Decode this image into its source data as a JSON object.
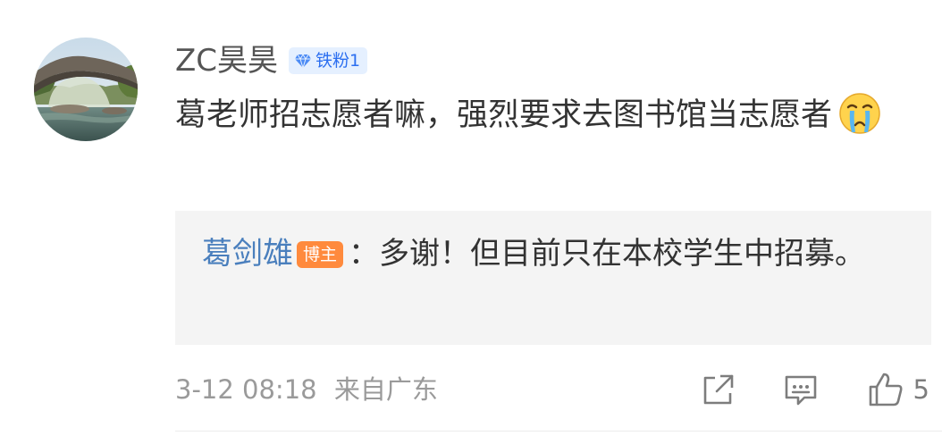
{
  "comment": {
    "username": "ZC昊昊",
    "fan_badge": "铁粉1",
    "text": "葛老师招志愿者嘛，强烈要求去图书馆当志愿者",
    "emoji": "crying-face"
  },
  "reply": {
    "author": "葛剑雄",
    "author_badge": "博主",
    "separator": "：",
    "text": "多谢！但目前只在本校学生中招募。"
  },
  "meta": {
    "time": "3-12 08:18",
    "source": "来自广东"
  },
  "actions": {
    "share_icon": "share-icon",
    "comment_icon": "comment-icon",
    "like_icon": "thumbs-up-icon",
    "like_count": "5"
  },
  "colors": {
    "link_blue": "#4a7fbd",
    "fan_badge_bg": "#e5f0ff",
    "fan_badge_text": "#2c6ff0",
    "host_badge_bg": "#ff8a3d",
    "reply_bg": "#f4f4f4",
    "meta_gray": "#9a9a9a"
  }
}
